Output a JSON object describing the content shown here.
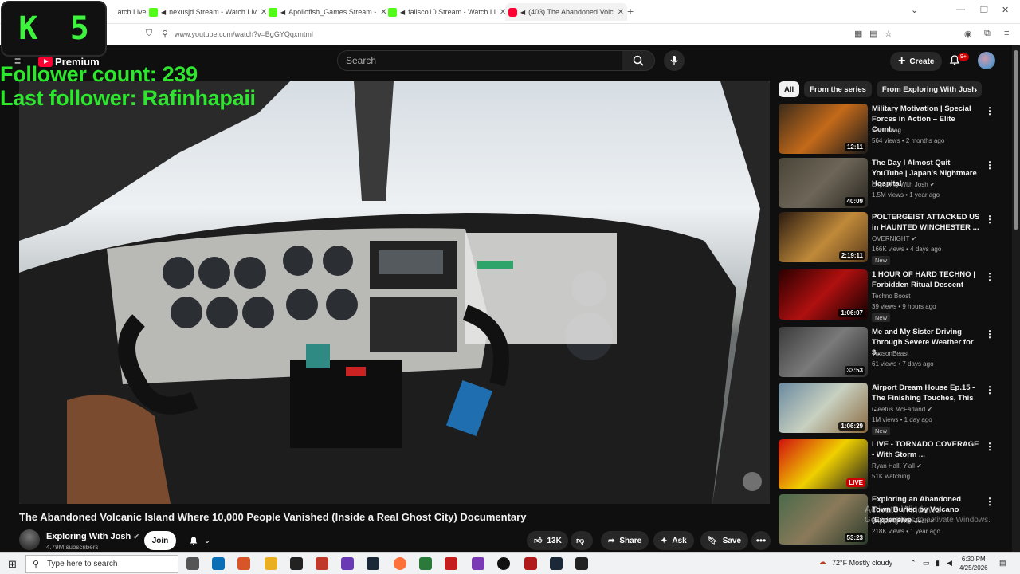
{
  "browser": {
    "tabs": [
      {
        "label": "...atch Live",
        "icon": "kick-icon",
        "audio": false
      },
      {
        "label": "nexusjd Stream - Watch Liv",
        "icon": "kick-icon",
        "audio": true
      },
      {
        "label": "Apollofish_Games Stream -",
        "icon": "kick-icon",
        "audio": true
      },
      {
        "label": "falisco10 Stream - Watch Li",
        "icon": "kick-icon",
        "audio": true
      },
      {
        "label": "(403) The Abandoned Volc",
        "icon": "youtube-icon",
        "audio": true
      }
    ],
    "url": "www.youtube.com/watch?v=BgGYQqxmtml"
  },
  "overlay": {
    "counter_left": "K",
    "counter_right": "5",
    "follower_count": "Follower count: 239",
    "last_follower": "Last follower: Rafinhapaii",
    "color": "#2ee62e"
  },
  "masthead": {
    "logo_label": "Premium",
    "search_placeholder": "Search",
    "create_label": "Create",
    "notif_badge": "9+"
  },
  "video": {
    "title": "The Abandoned Volcanic Island Where 10,000 People Vanished (Inside a Real Ghost City) Documentary",
    "channel": "Exploring With Josh",
    "subscribers": "4.79M subscribers",
    "join_label": "Join",
    "likes": "13K",
    "share_label": "Share",
    "ask_label": "Ask",
    "save_label": "Save"
  },
  "chips": [
    "All",
    "From the series",
    "From Exploring With Josh"
  ],
  "recommendations": [
    {
      "title": "Military Motivation | Special Forces in Action – Elite Comb...",
      "channel": "Soul Krieg",
      "verified": false,
      "meta": "564 views • 2 months ago",
      "duration": "12:11",
      "new": false,
      "thumb": "linear-gradient(135deg,#3a2a1a,#c46a1a 50%,#1a1a1a)"
    },
    {
      "title": "The Day I Almost Quit YouTube | Japan's Nightmare Hospital",
      "channel": "Exploring With Josh",
      "verified": true,
      "meta": "1.5M views • 1 year ago",
      "duration": "40:09",
      "new": false,
      "thumb": "linear-gradient(135deg,#4a4438,#6d6658 50%,#2a2620)"
    },
    {
      "title": "POLTERGEIST ATTACKED US in HAUNTED WINCHESTER ...",
      "channel": "OVERNIGHT",
      "verified": true,
      "meta": "166K views • 4 days ago",
      "duration": "2:19:11",
      "new": true,
      "thumb": "linear-gradient(135deg,#2a1a10,#c08a3a 55%,#5a3a1a)"
    },
    {
      "title": "1 HOUR OF HARD TECHNO | Forbidden Ritual Descent",
      "channel": "Techno Boost",
      "verified": false,
      "meta": "39 views • 9 hours ago",
      "duration": "1:06:07",
      "new": true,
      "thumb": "linear-gradient(135deg,#2a0000,#b01010 50%,#100000)"
    },
    {
      "title": "Me and My Sister Driving Through Severe Weather for 3...",
      "channel": "TucsonBeast",
      "verified": false,
      "meta": "61 views • 7 days ago",
      "duration": "33:53",
      "new": false,
      "thumb": "linear-gradient(135deg,#3a3a3a,#7a7a7a 50%,#2a2a2a)"
    },
    {
      "title": "Airport Dream House Ep.15 - The Finishing Touches, This ...",
      "channel": "Cleetus McFarland",
      "verified": true,
      "meta": "1M views • 1 day ago",
      "duration": "1:06:29",
      "new": true,
      "thumb": "linear-gradient(135deg,#6a8aa0,#c8d0c0 50%,#8a6a40)"
    },
    {
      "title": "LIVE - TORNADO COVERAGE - With Storm ...",
      "channel": "Ryan Hall, Y'all",
      "verified": true,
      "meta": "51K watching",
      "duration": "LIVE",
      "new": false,
      "live": true,
      "thumb": "linear-gradient(135deg,#d01010,#f0d000 50%,#202020)"
    },
    {
      "title": "Exploring an Abandoned Town Buried by Volcano (Expensive ...",
      "channel": "Exploring With Josh",
      "verified": true,
      "meta": "218K views • 1 year ago",
      "duration": "53:23",
      "new": false,
      "thumb": "linear-gradient(135deg,#4a6a4a,#8a7a5a 50%,#2a3a2a)"
    }
  ],
  "windows": {
    "activate_line1": "Activate Windows",
    "activate_line2": "Go to Settings to activate Windows."
  },
  "taskbar": {
    "search_placeholder": "Type here to search",
    "weather": "72°F  Mostly cloudy",
    "time": "6:30 PM",
    "date": "4/25/2026"
  }
}
